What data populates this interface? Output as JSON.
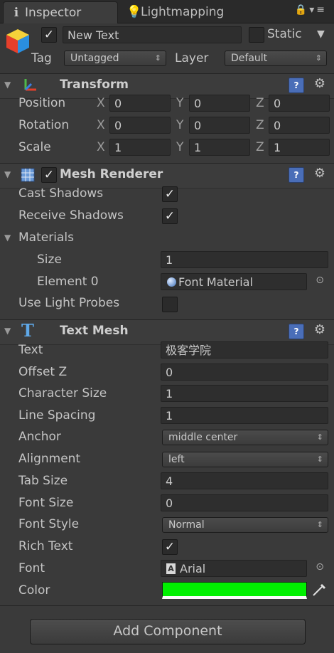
{
  "tabs": [
    {
      "label": "Inspector",
      "icon": "info-icon"
    },
    {
      "label": "Lightmapping",
      "icon": "lightbulb-icon"
    }
  ],
  "object": {
    "name": "New Text",
    "active": true,
    "static_label": "Static",
    "static_checked": false,
    "tag_label": "Tag",
    "tag_value": "Untagged",
    "layer_label": "Layer",
    "layer_value": "Default"
  },
  "transform": {
    "title": "Transform",
    "position": {
      "label": "Position",
      "x": "0",
      "y": "0",
      "z": "0"
    },
    "rotation": {
      "label": "Rotation",
      "x": "0",
      "y": "0",
      "z": "0"
    },
    "scale": {
      "label": "Scale",
      "x": "1",
      "y": "1",
      "z": "1"
    },
    "axis_x": "X",
    "axis_y": "Y",
    "axis_z": "Z"
  },
  "mesh_renderer": {
    "title": "Mesh Renderer",
    "enabled": true,
    "cast_shadows_label": "Cast Shadows",
    "cast_shadows": true,
    "receive_shadows_label": "Receive Shadows",
    "receive_shadows": true,
    "materials_label": "Materials",
    "size_label": "Size",
    "size_value": "1",
    "element0_label": "Element 0",
    "element0_value": "Font Material",
    "light_probes_label": "Use Light Probes",
    "light_probes": false
  },
  "text_mesh": {
    "title": "Text Mesh",
    "text_label": "Text",
    "text_value": "极客学院",
    "offset_z_label": "Offset Z",
    "offset_z": "0",
    "char_size_label": "Character Size",
    "char_size": "1",
    "line_spacing_label": "Line Spacing",
    "line_spacing": "1",
    "anchor_label": "Anchor",
    "anchor": "middle center",
    "alignment_label": "Alignment",
    "alignment": "left",
    "tab_size_label": "Tab Size",
    "tab_size": "4",
    "font_size_label": "Font Size",
    "font_size": "0",
    "font_style_label": "Font Style",
    "font_style": "Normal",
    "rich_text_label": "Rich Text",
    "rich_text": true,
    "font_label": "Font",
    "font": "Arial",
    "color_label": "Color",
    "color": "#00f000"
  },
  "add_component_label": "Add Component",
  "colors": {
    "accent": "#4a6eb8",
    "bg": "#3a3a3a"
  }
}
